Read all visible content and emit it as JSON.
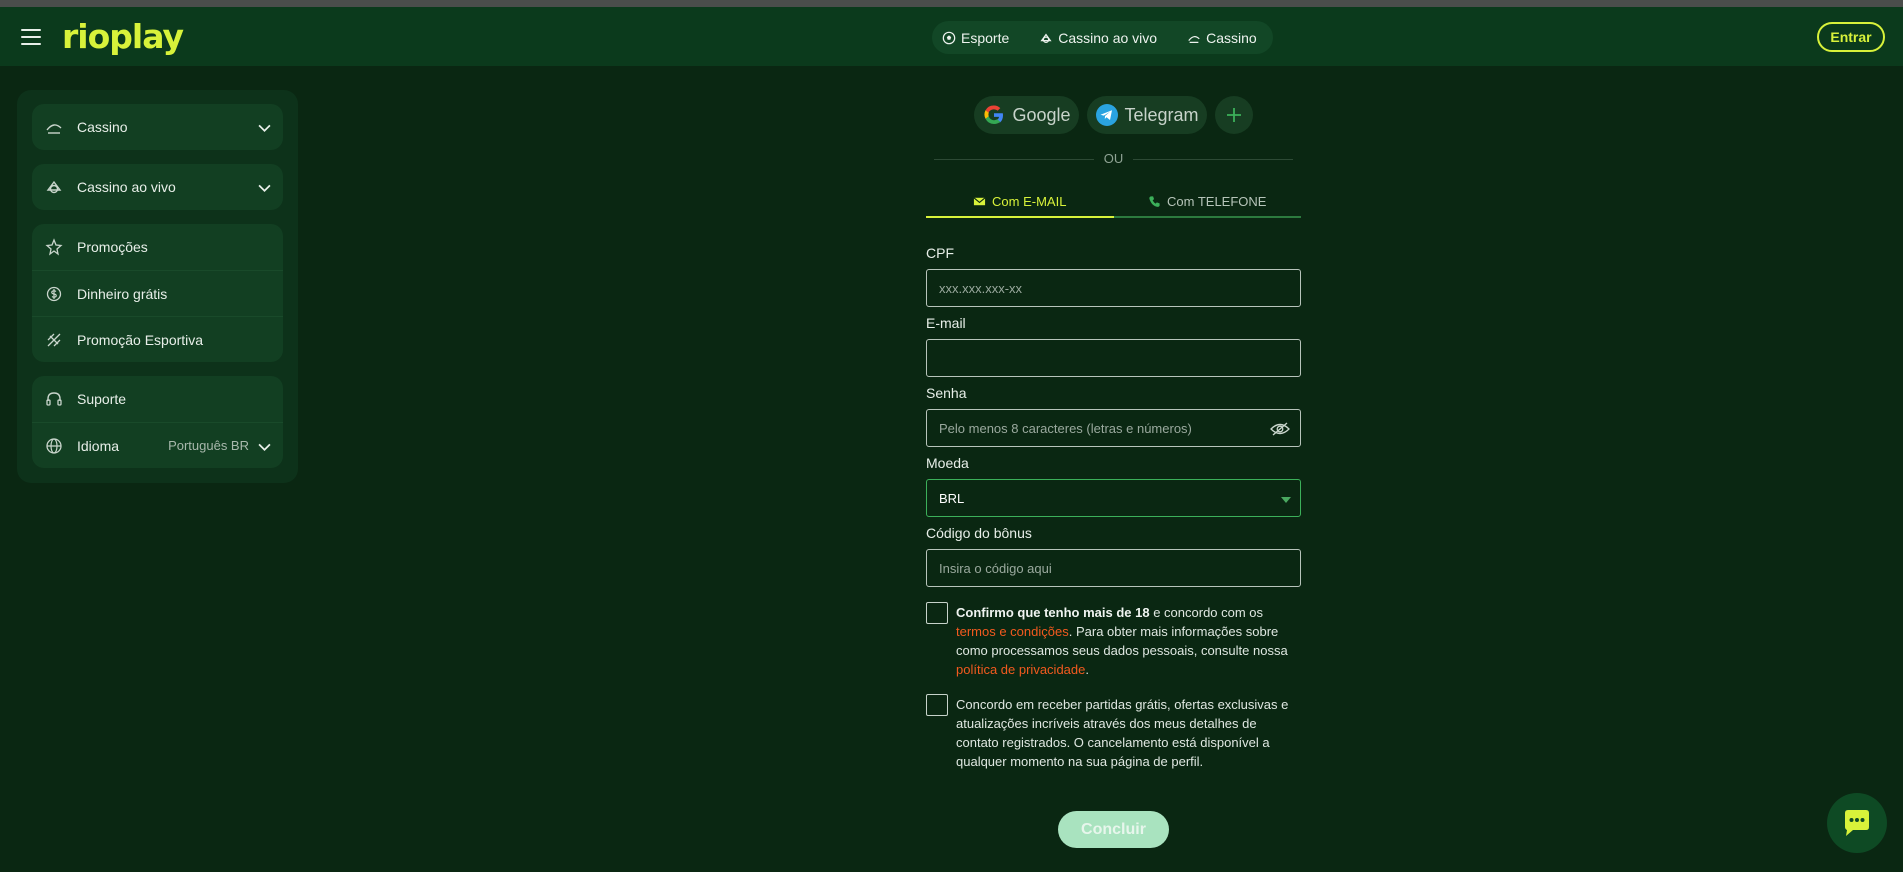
{
  "brand": {
    "logo_text": "rioplay",
    "accent": "#d8f23a"
  },
  "header": {
    "nav": [
      {
        "label": "Esporte",
        "icon": "soccer-ball-icon"
      },
      {
        "label": "Cassino ao vivo",
        "icon": "live-casino-icon"
      },
      {
        "label": "Cassino",
        "icon": "casino-icon"
      }
    ],
    "login_label": "Entrar"
  },
  "sidebar": {
    "casino": "Cassino",
    "live_casino": "Cassino ao vivo",
    "promotions": "Promoções",
    "free_money": "Dinheiro grátis",
    "sports_promo": "Promoção Esportiva",
    "support": "Suporte",
    "language_label": "Idioma",
    "language_value": "Português BR"
  },
  "social": {
    "google": "Google",
    "telegram": "Telegram"
  },
  "divider_text": "OU",
  "tabs": {
    "email": "Com E-MAIL",
    "phone": "Com TELEFONE"
  },
  "form": {
    "cpf_label": "CPF",
    "cpf_placeholder": "xxx.xxx.xxx-xx",
    "email_label": "E-mail",
    "email_value": "",
    "password_label": "Senha",
    "password_placeholder": "Pelo menos 8 caracteres (letras e números)",
    "currency_label": "Moeda",
    "currency_value": "BRL",
    "bonus_label": "Código do bônus",
    "bonus_placeholder": "Insira o código aqui"
  },
  "consent": {
    "age_bold": "Confirmo que tenho mais de 18",
    "age_text1": " e concordo com os ",
    "terms_link": "termos e condições",
    "age_text2": ". Para obter mais informações sobre como processamos seus dados pessoais, consulte nossa ",
    "privacy_link": "política de privacidade",
    "age_text3": ".",
    "marketing": "Concordo em receber partidas grátis, ofertas exclusivas e atualizações incríveis através dos meus detalhes de contato registrados. O cancelamento está disponível a qualquer momento na sua página de perfil."
  },
  "submit_label": "Concluir"
}
